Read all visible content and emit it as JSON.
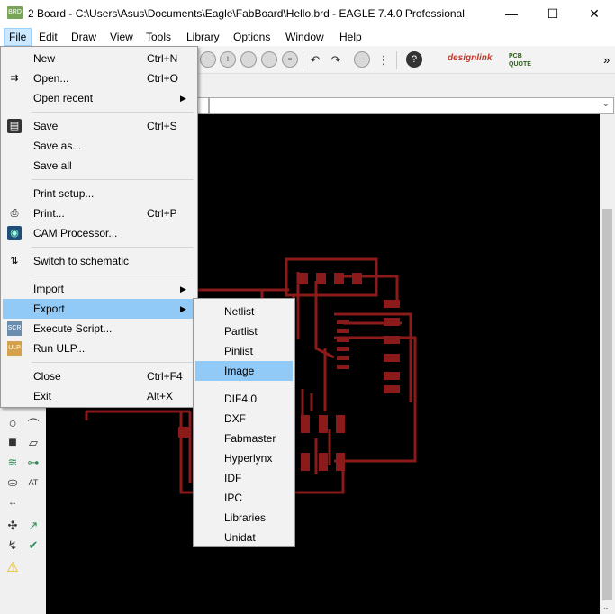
{
  "window": {
    "app_icon": "BRD",
    "title": "2 Board - C:\\Users\\Asus\\Documents\\Eagle\\FabBoard\\Hello.brd - EAGLE 7.4.0 Professional",
    "minimize": "—",
    "maximize": "☐",
    "close": "✕"
  },
  "menubar": {
    "items": [
      "File",
      "Edit",
      "Draw",
      "View",
      "Tools",
      "Library",
      "Options",
      "Window",
      "Help"
    ]
  },
  "toolbar": {
    "designlink": "designlink",
    "pcb_quote": "PCB QUOTE",
    "overflow": "»"
  },
  "file_menu": {
    "items": [
      {
        "label": "New",
        "shortcut": "Ctrl+N"
      },
      {
        "label": "Open...",
        "shortcut": "Ctrl+O"
      },
      {
        "label": "Open recent",
        "arrow": "▶"
      },
      {
        "label": "Save",
        "shortcut": "Ctrl+S"
      },
      {
        "label": "Save as..."
      },
      {
        "label": "Save all"
      },
      {
        "label": "Print setup..."
      },
      {
        "label": "Print...",
        "shortcut": "Ctrl+P"
      },
      {
        "label": "CAM Processor..."
      },
      {
        "label": "Switch to schematic"
      },
      {
        "label": "Import",
        "arrow": "▶"
      },
      {
        "label": "Export",
        "arrow": "▶"
      },
      {
        "label": "Execute Script..."
      },
      {
        "label": "Run ULP..."
      },
      {
        "label": "Close",
        "shortcut": "Ctrl+F4"
      },
      {
        "label": "Exit",
        "shortcut": "Alt+X"
      }
    ],
    "icon_labels": {
      "execute_script": "SCR",
      "run_ulp": "ULP"
    }
  },
  "export_menu": {
    "items": [
      "Netlist",
      "Partlist",
      "Pinlist",
      "Image",
      "DIF4.0",
      "DXF",
      "Fabmaster",
      "Hyperlynx",
      "IDF",
      "IPC",
      "Libraries",
      "Unidat"
    ]
  },
  "colors": {
    "trace": "#8b1a1a",
    "menu_highlight": "#91c9f7",
    "canvas": "#000000"
  }
}
